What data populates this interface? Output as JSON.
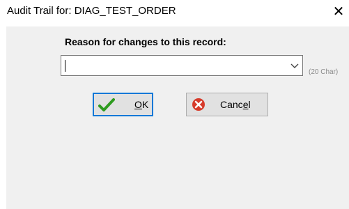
{
  "window": {
    "title": "Audit Trail for: DIAG_TEST_ORDER",
    "close_glyph": "✕"
  },
  "form": {
    "reason_label": "Reason for changes to this record:",
    "reason_value": "",
    "char_hint": "(20 Char)"
  },
  "buttons": {
    "ok": {
      "mnemonic": "O",
      "rest": "K",
      "icon": "checkmark-icon"
    },
    "cancel": {
      "pre": "Canc",
      "mnemonic": "e",
      "rest": "l",
      "icon": "cancel-x-icon"
    }
  },
  "colors": {
    "focus_border": "#0078d7",
    "check_green": "#2e9b1f",
    "cancel_red": "#d63a2a"
  }
}
